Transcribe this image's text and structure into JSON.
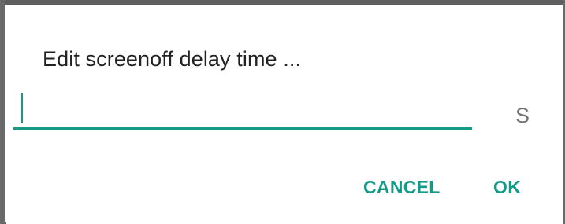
{
  "dialog": {
    "title": "Edit screenoff delay time ...",
    "input": {
      "value": "",
      "placeholder": ""
    },
    "unit_label": "S",
    "buttons": {
      "cancel_label": "CANCEL",
      "ok_label": "OK"
    }
  },
  "colors": {
    "accent": "#159a87",
    "title_text": "#212121",
    "unit_text": "#757575",
    "background": "#ffffff",
    "frame": "#5f5f5f"
  }
}
